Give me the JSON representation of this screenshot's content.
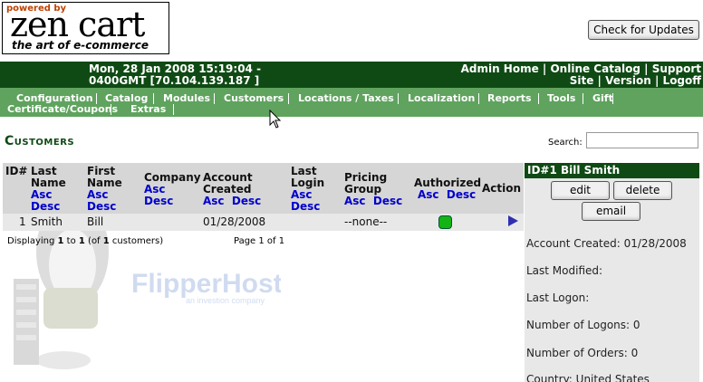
{
  "logo": {
    "powered_by": "powered by",
    "brand": "zen cart",
    "tagline": "the art of e-commerce"
  },
  "check_updates_label": "Check for Updates",
  "header": {
    "datetime_line1": "Mon, 28 Jan 2008 15:19:04 -",
    "datetime_line2": "0400GMT [70.104.139.187 ]",
    "links_line1": "Admin Home | Online Catalog | Support",
    "links_line2": "Site | Version | Logoff"
  },
  "nav": {
    "configuration": "Configuration",
    "catalog": "Catalog",
    "modules": "Modules",
    "customers": "Customers",
    "locations": "Locations / Taxes",
    "localization": "Localization",
    "reports": "Reports",
    "tools": "Tools",
    "gift_part1": "Gift",
    "gift_part2": "Certificate/Coupons",
    "extras": "Extras"
  },
  "page_title": "Customers",
  "search": {
    "label": "Search:",
    "value": ""
  },
  "table": {
    "headers": {
      "id": "ID#",
      "last_name_1": "Last",
      "last_name_2": "Name",
      "first_name_1": "First",
      "first_name_2": "Name",
      "company": "Company",
      "account_created_1": "Account",
      "account_created_2": "Created",
      "last_login_1": "Last",
      "last_login_2": "Login",
      "pricing_group_1": "Pricing",
      "pricing_group_2": "Group",
      "authorized": "Authorized",
      "action": "Action"
    },
    "sort_asc": "Asc",
    "sort_desc": "Desc",
    "rows": [
      {
        "id": "1",
        "last_name": "Smith",
        "first_name": "Bill",
        "company": "",
        "account_created": "01/28/2008",
        "last_login": "",
        "pricing_group": "--none--",
        "authorized": true
      }
    ],
    "displaying_prefix": "Displaying ",
    "displaying_from": "1",
    "displaying_to_word": " to ",
    "displaying_to": "1",
    "displaying_of_open": " (of ",
    "displaying_total": "1",
    "displaying_suffix": " customers)",
    "page_label": "Page 1 of 1"
  },
  "panel": {
    "title": "ID#1 Bill Smith",
    "edit": "edit",
    "delete": "delete",
    "email": "email",
    "account_created": "Account Created: 01/28/2008",
    "last_modified": "Last Modified:",
    "last_logon": "Last Logon:",
    "number_of_logons": "Number of Logons: 0",
    "number_of_orders": "Number of Orders: 0",
    "country": "Country: United States"
  },
  "watermark": {
    "text1": "FlipperHost",
    "text2": "an investion company"
  },
  "colors": {
    "header_green": "#0f4a14",
    "nav_green": "#5fa35e",
    "link_blue": "#0000cc",
    "authorized_green": "#14b414"
  }
}
